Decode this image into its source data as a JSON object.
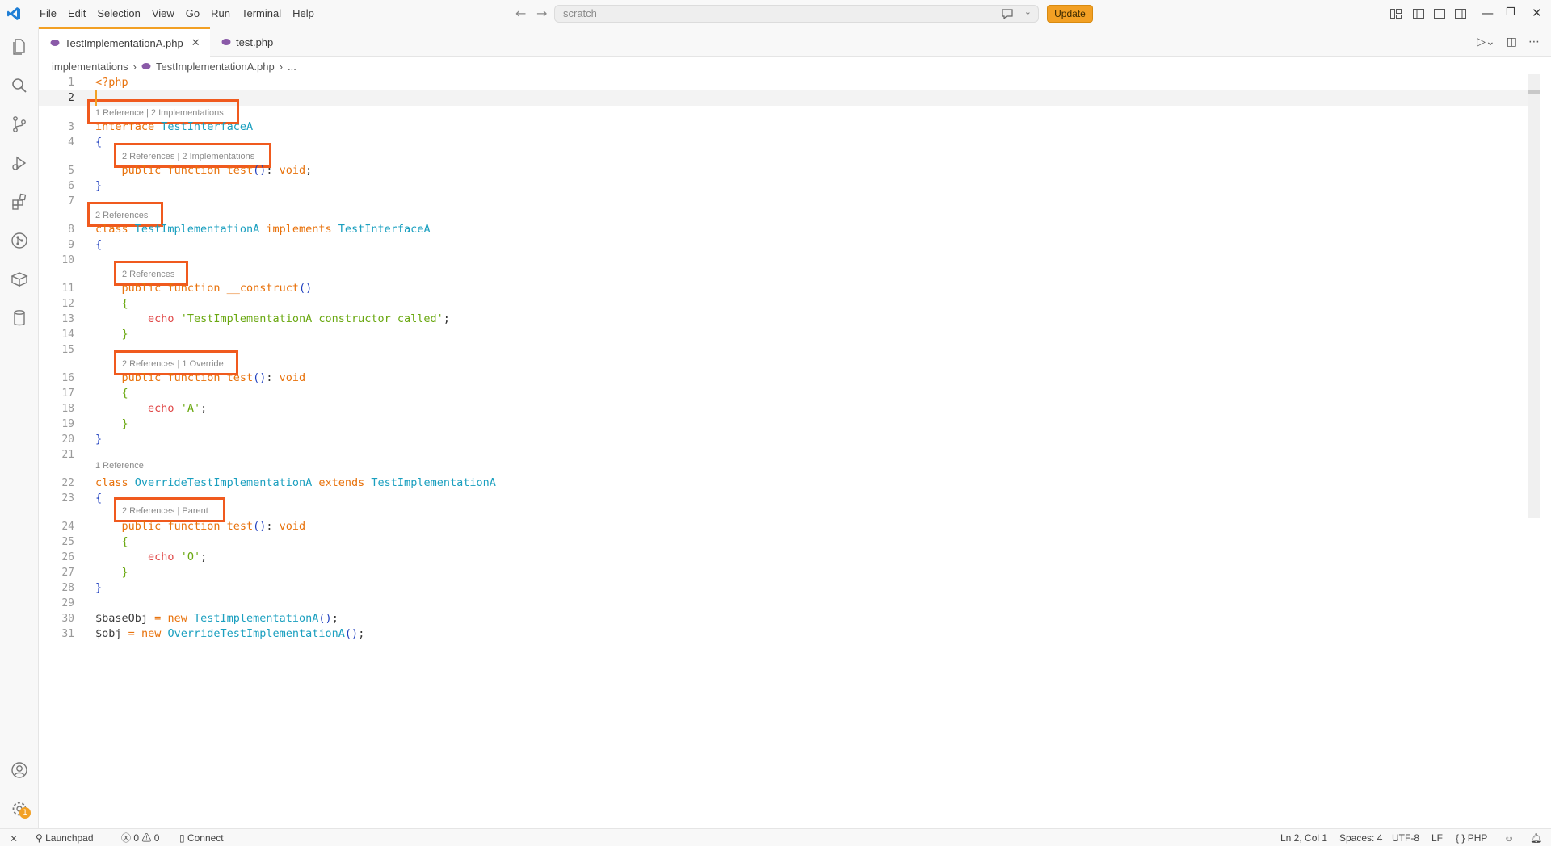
{
  "titlebar": {
    "menu": [
      "File",
      "Edit",
      "Selection",
      "View",
      "Go",
      "Run",
      "Terminal",
      "Help"
    ],
    "search_placeholder": "scratch",
    "update_label": "Update"
  },
  "tabs": [
    {
      "label": "TestImplementationA.php",
      "active": true
    },
    {
      "label": "test.php",
      "active": false
    }
  ],
  "breadcrumb": {
    "folder": "implementations",
    "file": "TestImplementationA.php",
    "more": "..."
  },
  "editor": {
    "current_line": 2,
    "lines": [
      {
        "n": "1",
        "code": "<?php"
      },
      {
        "n": "2",
        "code": ""
      },
      {
        "n": "3",
        "code": "interface TestInterfaceA"
      },
      {
        "n": "4",
        "code": "{"
      },
      {
        "n": "5",
        "code": "    public function test(): void;"
      },
      {
        "n": "6",
        "code": "}"
      },
      {
        "n": "7",
        "code": ""
      },
      {
        "n": "8",
        "code": "class TestImplementationA implements TestInterfaceA"
      },
      {
        "n": "9",
        "code": "{"
      },
      {
        "n": "10",
        "code": ""
      },
      {
        "n": "11",
        "code": "    public function __construct()"
      },
      {
        "n": "12",
        "code": "    {"
      },
      {
        "n": "13",
        "code": "        echo 'TestImplementationA constructor called';"
      },
      {
        "n": "14",
        "code": "    }"
      },
      {
        "n": "15",
        "code": ""
      },
      {
        "n": "16",
        "code": "    public function test(): void"
      },
      {
        "n": "17",
        "code": "    {"
      },
      {
        "n": "18",
        "code": "        echo 'A';"
      },
      {
        "n": "19",
        "code": "    }"
      },
      {
        "n": "20",
        "code": "}"
      },
      {
        "n": "21",
        "code": ""
      },
      {
        "n": "22",
        "code": "class OverrideTestImplementationA extends TestImplementationA"
      },
      {
        "n": "23",
        "code": "{"
      },
      {
        "n": "24",
        "code": "    public function test(): void"
      },
      {
        "n": "25",
        "code": "    {"
      },
      {
        "n": "26",
        "code": "        echo 'O';"
      },
      {
        "n": "27",
        "code": "    }"
      },
      {
        "n": "28",
        "code": "}"
      },
      {
        "n": "29",
        "code": ""
      },
      {
        "n": "30",
        "code": "$baseObj = new TestImplementationA();"
      },
      {
        "n": "31",
        "code": "$obj = new OverrideTestImplementationA();"
      }
    ],
    "code_lenses": [
      {
        "text": "1 Reference | 2 Implementations",
        "highlighted": true
      },
      {
        "text": "2 References | 2 Implementations",
        "highlighted": true
      },
      {
        "text": "2 References",
        "highlighted": true
      },
      {
        "text": "2 References",
        "highlighted": true
      },
      {
        "text": "2 References | 1 Override",
        "highlighted": true
      },
      {
        "text": "1 Reference",
        "highlighted": false
      },
      {
        "text": "2 References | Parent",
        "highlighted": true
      }
    ]
  },
  "statusbar": {
    "launchpad": "Launchpad",
    "errors": "0",
    "warnings": "0",
    "connect": "Connect",
    "position": "Ln 2, Col 1",
    "spaces": "Spaces: 4",
    "encoding": "UTF-8",
    "eol": "LF",
    "language": "PHP",
    "settings_badge": "1"
  },
  "colors": {
    "accent": "#f2a024",
    "highlight_box": "#f05a1e",
    "keyword": "#e8720c",
    "class_name": "#1a9fbf",
    "string": "#6aa811"
  }
}
